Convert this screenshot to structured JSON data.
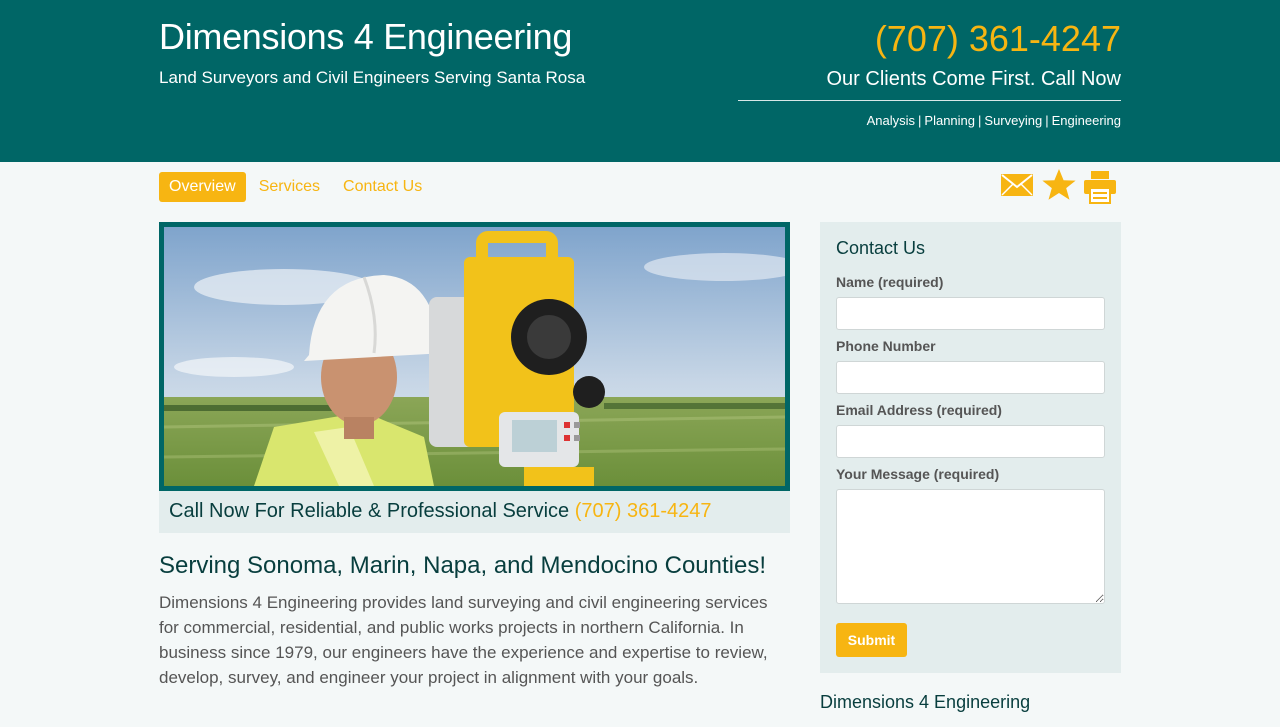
{
  "header": {
    "title": "Dimensions 4 Engineering",
    "tagline": "Land Surveyors and Civil Engineers Serving Santa Rosa",
    "phone": "(707) 361-4247",
    "cta": "Our Clients Come First. Call Now",
    "links": [
      "Analysis",
      "Planning",
      "Surveying",
      "Engineering"
    ],
    "link_separator": "|"
  },
  "nav": {
    "items": [
      "Overview",
      "Services",
      "Contact Us"
    ],
    "active": "Overview"
  },
  "tools": {
    "icons": [
      "email-icon",
      "star-icon",
      "print-icon"
    ]
  },
  "hero": {
    "image": "surveyor-with-theodolite-photo"
  },
  "callbar": {
    "text": "Call Now For Reliable & Professional Service",
    "phone": "(707) 361-4247"
  },
  "main": {
    "heading": "Serving Sonoma, Marin, Napa, and Mendocino Counties!",
    "body": "Dimensions 4 Engineering provides land surveying and civil engineering services for commercial, residential, and public works projects in northern California. In business since 1979, our engineers have the experience and expertise to review, develop, survey, and engineer your project in alignment with your goals."
  },
  "contact_form": {
    "title": "Contact Us",
    "name_label": "Name (required)",
    "phone_label": "Phone Number",
    "email_label": "Email Address (required)",
    "message_label": "Your Message (required)",
    "submit_label": "Submit"
  },
  "sidebar": {
    "company": "Dimensions 4 Engineering"
  },
  "colors": {
    "teal": "#006666",
    "accent": "#f7b512",
    "panel": "#e3eded",
    "page": "#f4f8f8"
  }
}
